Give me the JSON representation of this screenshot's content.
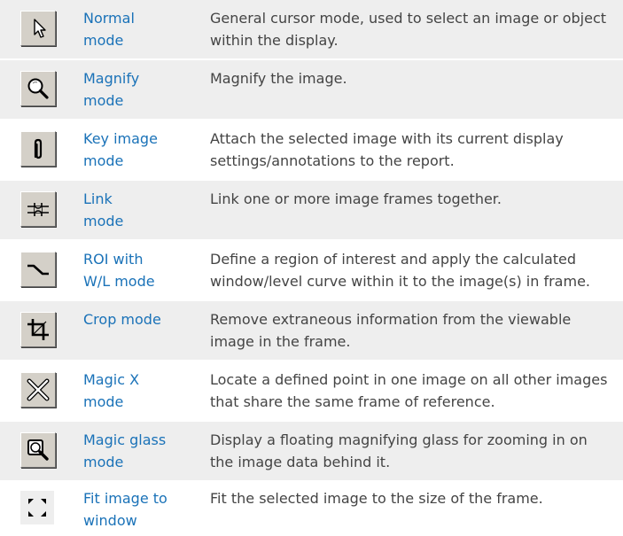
{
  "rows": [
    {
      "icon": "arrow-cursor-icon",
      "mode_line1": "Normal",
      "mode_line2": "mode",
      "description": "General cursor mode, used to select an image or object within the display."
    },
    {
      "icon": "magnifier-icon",
      "mode_line1": "Magnify",
      "mode_line2": "mode",
      "description": "Magnify the image."
    },
    {
      "icon": "paperclip-icon",
      "mode_line1": "Key image",
      "mode_line2": "mode",
      "description": "Attach the selected image with its current display settings/annotations to the report."
    },
    {
      "icon": "link-icon",
      "mode_line1": "Link",
      "mode_line2": "mode",
      "description": "Link one or more image frames together."
    },
    {
      "icon": "roi-curve-icon",
      "mode_line1": "ROI with",
      "mode_line2": "W/L mode",
      "description": "Define a region of interest and apply the calculated window/level curve within it to the image(s) in frame."
    },
    {
      "icon": "crop-icon",
      "mode_line1": "Crop mode",
      "mode_line2": "",
      "description": "Remove extraneous information from the viewable image in the frame."
    },
    {
      "icon": "magic-x-icon",
      "mode_line1": "Magic X",
      "mode_line2": "mode",
      "description": "Locate a defined point in one image on all other images that share the same frame of reference."
    },
    {
      "icon": "magic-glass-icon",
      "mode_line1": "Magic glass",
      "mode_line2": "mode",
      "description": "Display a floating magnifying glass for zooming in on the image data behind it."
    },
    {
      "icon": "fit-window-icon",
      "mode_line1": "Fit image to",
      "mode_line2": "window",
      "description": "Fit the selected image to the size of the frame."
    }
  ],
  "colors": {
    "mode_text": "#1a72b8",
    "desc_text": "#444444",
    "row_bg": "#eeeeee",
    "button_face": "#d4d0c8"
  }
}
